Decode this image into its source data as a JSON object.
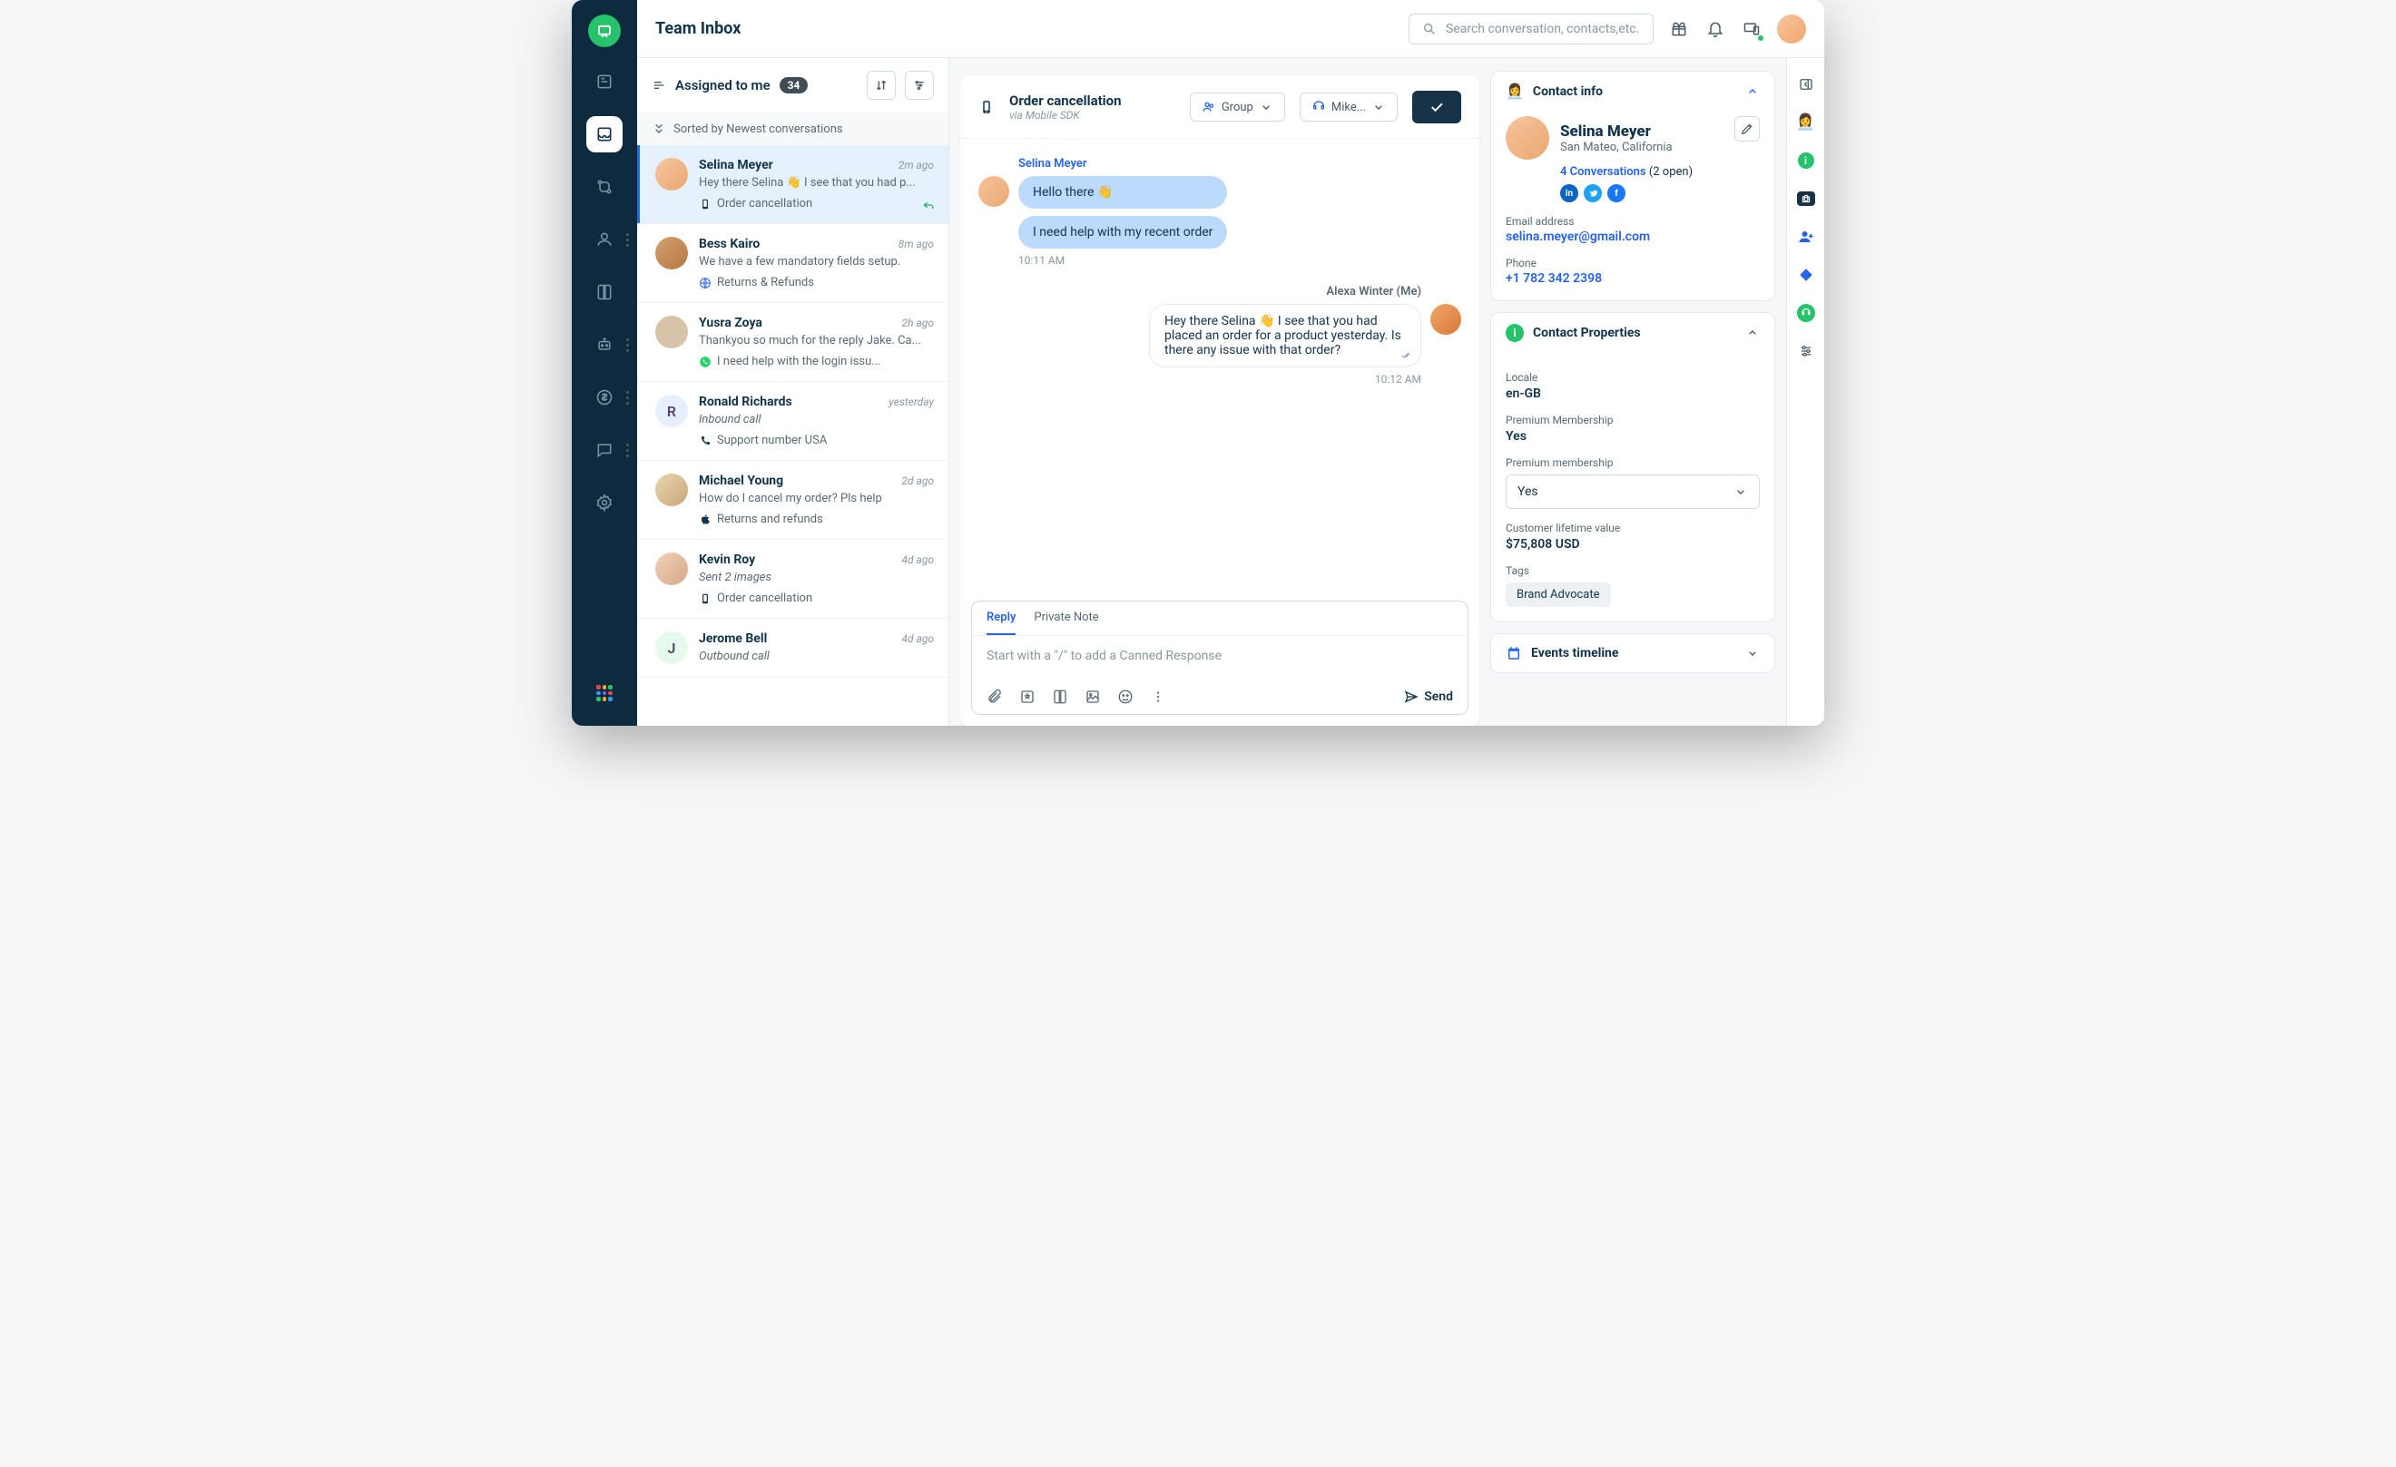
{
  "header": {
    "title": "Team Inbox",
    "search_placeholder": "Search conversation, contacts,etc."
  },
  "list": {
    "filter_label": "Assigned to me",
    "count": "34",
    "sort_label": "Sorted by Newest conversations"
  },
  "conversations": [
    {
      "name": "Selina Meyer",
      "time": "2m ago",
      "preview": "Hey there Selina 👋 I see that you had p...",
      "tag": "Order cancellation",
      "avatar_bg": "linear-gradient(135deg,#f7c59f,#e8a86f)",
      "initial": "",
      "active": true,
      "reply": true,
      "channel": "mobile"
    },
    {
      "name": "Bess Kairo",
      "time": "8m ago",
      "preview": "We have a few mandatory fields setup.",
      "tag": "Returns & Refunds",
      "avatar_bg": "linear-gradient(135deg,#d4a06f,#b57845)",
      "initial": "",
      "channel": "web"
    },
    {
      "name": "Yusra Zoya",
      "time": "2h ago",
      "preview": "Thankyou so much for the reply Jake. Ca...",
      "tag": "I need help with the login issu...",
      "avatar_bg": "#d6c3a8",
      "initial": "",
      "channel": "whatsapp"
    },
    {
      "name": "Ronald Richards",
      "time": "yesterday",
      "preview": "Inbound call",
      "preview_italic": true,
      "tag": "Support number USA",
      "avatar_bg": "#e5efff",
      "initial": "R",
      "channel": "phone"
    },
    {
      "name": "Michael Young",
      "time": "2d ago",
      "preview": "How do I cancel my order? Pls help",
      "tag": "Returns and refunds",
      "avatar_bg": "linear-gradient(135deg,#e8d4b0,#c9a878)",
      "initial": "",
      "channel": "apple"
    },
    {
      "name": "Kevin Roy",
      "time": "4d ago",
      "preview": "Sent 2 images",
      "preview_italic": true,
      "tag": "Order cancellation",
      "avatar_bg": "linear-gradient(135deg,#f0d0b8,#d8a888)",
      "initial": "",
      "channel": "mobile"
    },
    {
      "name": "Jerome Bell",
      "time": "4d ago",
      "preview": "Outbound call",
      "preview_italic": true,
      "tag": "",
      "avatar_bg": "#e5f9ed",
      "initial": "J"
    }
  ],
  "chat": {
    "title": "Order cancellation",
    "subtitle": "via Mobile SDK",
    "group_label": "Group",
    "agent_label": "Mike...",
    "messages": {
      "customer": {
        "name": "Selina Meyer",
        "b1": "Hello there 👋",
        "b2": "I need help with my recent order",
        "time": "10:11 AM"
      },
      "agent": {
        "name": "Alexa Winter (Me)",
        "text": "Hey there Selina 👋 I see that you had placed an order for a product yesterday. Is there any issue with that order?",
        "time": "10:12 AM"
      }
    },
    "reply_tab": "Reply",
    "note_tab": "Private Note",
    "reply_placeholder": "Start with a \"/\" to add a Canned Response",
    "send_label": "Send"
  },
  "contact": {
    "panel_title": "Contact info",
    "name": "Selina Meyer",
    "location": "San Mateo, California",
    "conv_link": "4 Conversations",
    "conv_open": "(2 open)",
    "email_label": "Email address",
    "email": "selina.meyer@gmail.com",
    "phone_label": "Phone",
    "phone": "+1 782 342 2398"
  },
  "properties": {
    "panel_title": "Contact Properties",
    "locale_label": "Locale",
    "locale": "en-GB",
    "premium_label": "Premium Membership",
    "premium": "Yes",
    "premium2_label": "Premium membership",
    "premium2": "Yes",
    "clv_label": "Customer lifetime value",
    "clv": "$75,808 USD",
    "tags_label": "Tags",
    "tag": "Brand Advocate"
  },
  "events": {
    "panel_title": "Events timeline"
  }
}
